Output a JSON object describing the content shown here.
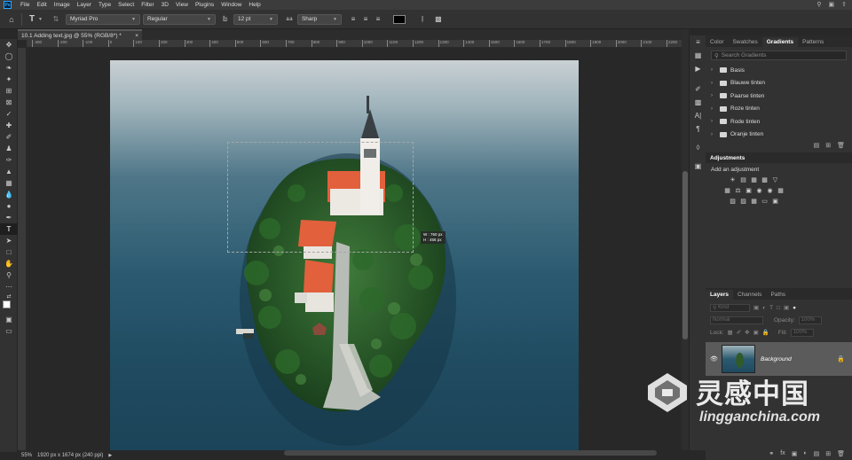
{
  "app": {
    "logo": "Ps"
  },
  "menubar": {
    "items": [
      "File",
      "Edit",
      "Image",
      "Layer",
      "Type",
      "Select",
      "Filter",
      "3D",
      "View",
      "Plugins",
      "Window",
      "Help"
    ],
    "right_icons": [
      "search-icon",
      "workspace-icon",
      "share-icon"
    ]
  },
  "options": {
    "font_family": "Myriad Pro",
    "font_style": "Regular",
    "font_size": "12 pt",
    "antialias": "Sharp",
    "text_color": "#000000"
  },
  "document": {
    "tab_title": "10.1 Adding text.jpg @ 55% (RGB/8*) *",
    "close": "×",
    "size_tip_w": "W : 760 px",
    "size_tip_h": "H : 456 px"
  },
  "rulers": {
    "top_ticks": [
      "-300",
      "-200",
      "-100",
      "0",
      "100",
      "200",
      "300",
      "400",
      "500",
      "600",
      "700",
      "800",
      "900",
      "1000",
      "1100",
      "1200",
      "1300",
      "1400",
      "1500",
      "1600",
      "1700",
      "1800",
      "1900",
      "2000",
      "2100",
      "2200"
    ]
  },
  "status": {
    "zoom": "55%",
    "doc_info": "1920 px x 1674 px (240 ppi)"
  },
  "gradients_panel": {
    "tabs": [
      "Color",
      "Swatches",
      "Gradients",
      "Patterns"
    ],
    "active_tab": "Gradients",
    "search_placeholder": "Search Gradients",
    "folders": [
      "Basis",
      "Blauwe tinten",
      "Paarse tinten",
      "Roze tinten",
      "Rode tinten",
      "Oranje tinten"
    ]
  },
  "adjustments_panel": {
    "title": "Adjustments",
    "subtitle": "Add an adjustment"
  },
  "layers_panel": {
    "tabs": [
      "Layers",
      "Channels",
      "Paths"
    ],
    "active_tab": "Layers",
    "filter_kind": "Kind",
    "blend_mode": "Normal",
    "opacity_label": "Opacity:",
    "opacity_value": "100%",
    "lock_label": "Lock:",
    "fill_label": "Fill:",
    "fill_value": "100%",
    "layers": [
      {
        "name": "Background",
        "visible": true,
        "locked": true
      }
    ]
  },
  "watermark": {
    "title": "灵感中国",
    "url": "lingganchina.com"
  },
  "colors": {
    "accent": "#31a8ff",
    "roof": "#e2603c",
    "water": "#2b5a70",
    "trees": "#2e5d2a"
  }
}
